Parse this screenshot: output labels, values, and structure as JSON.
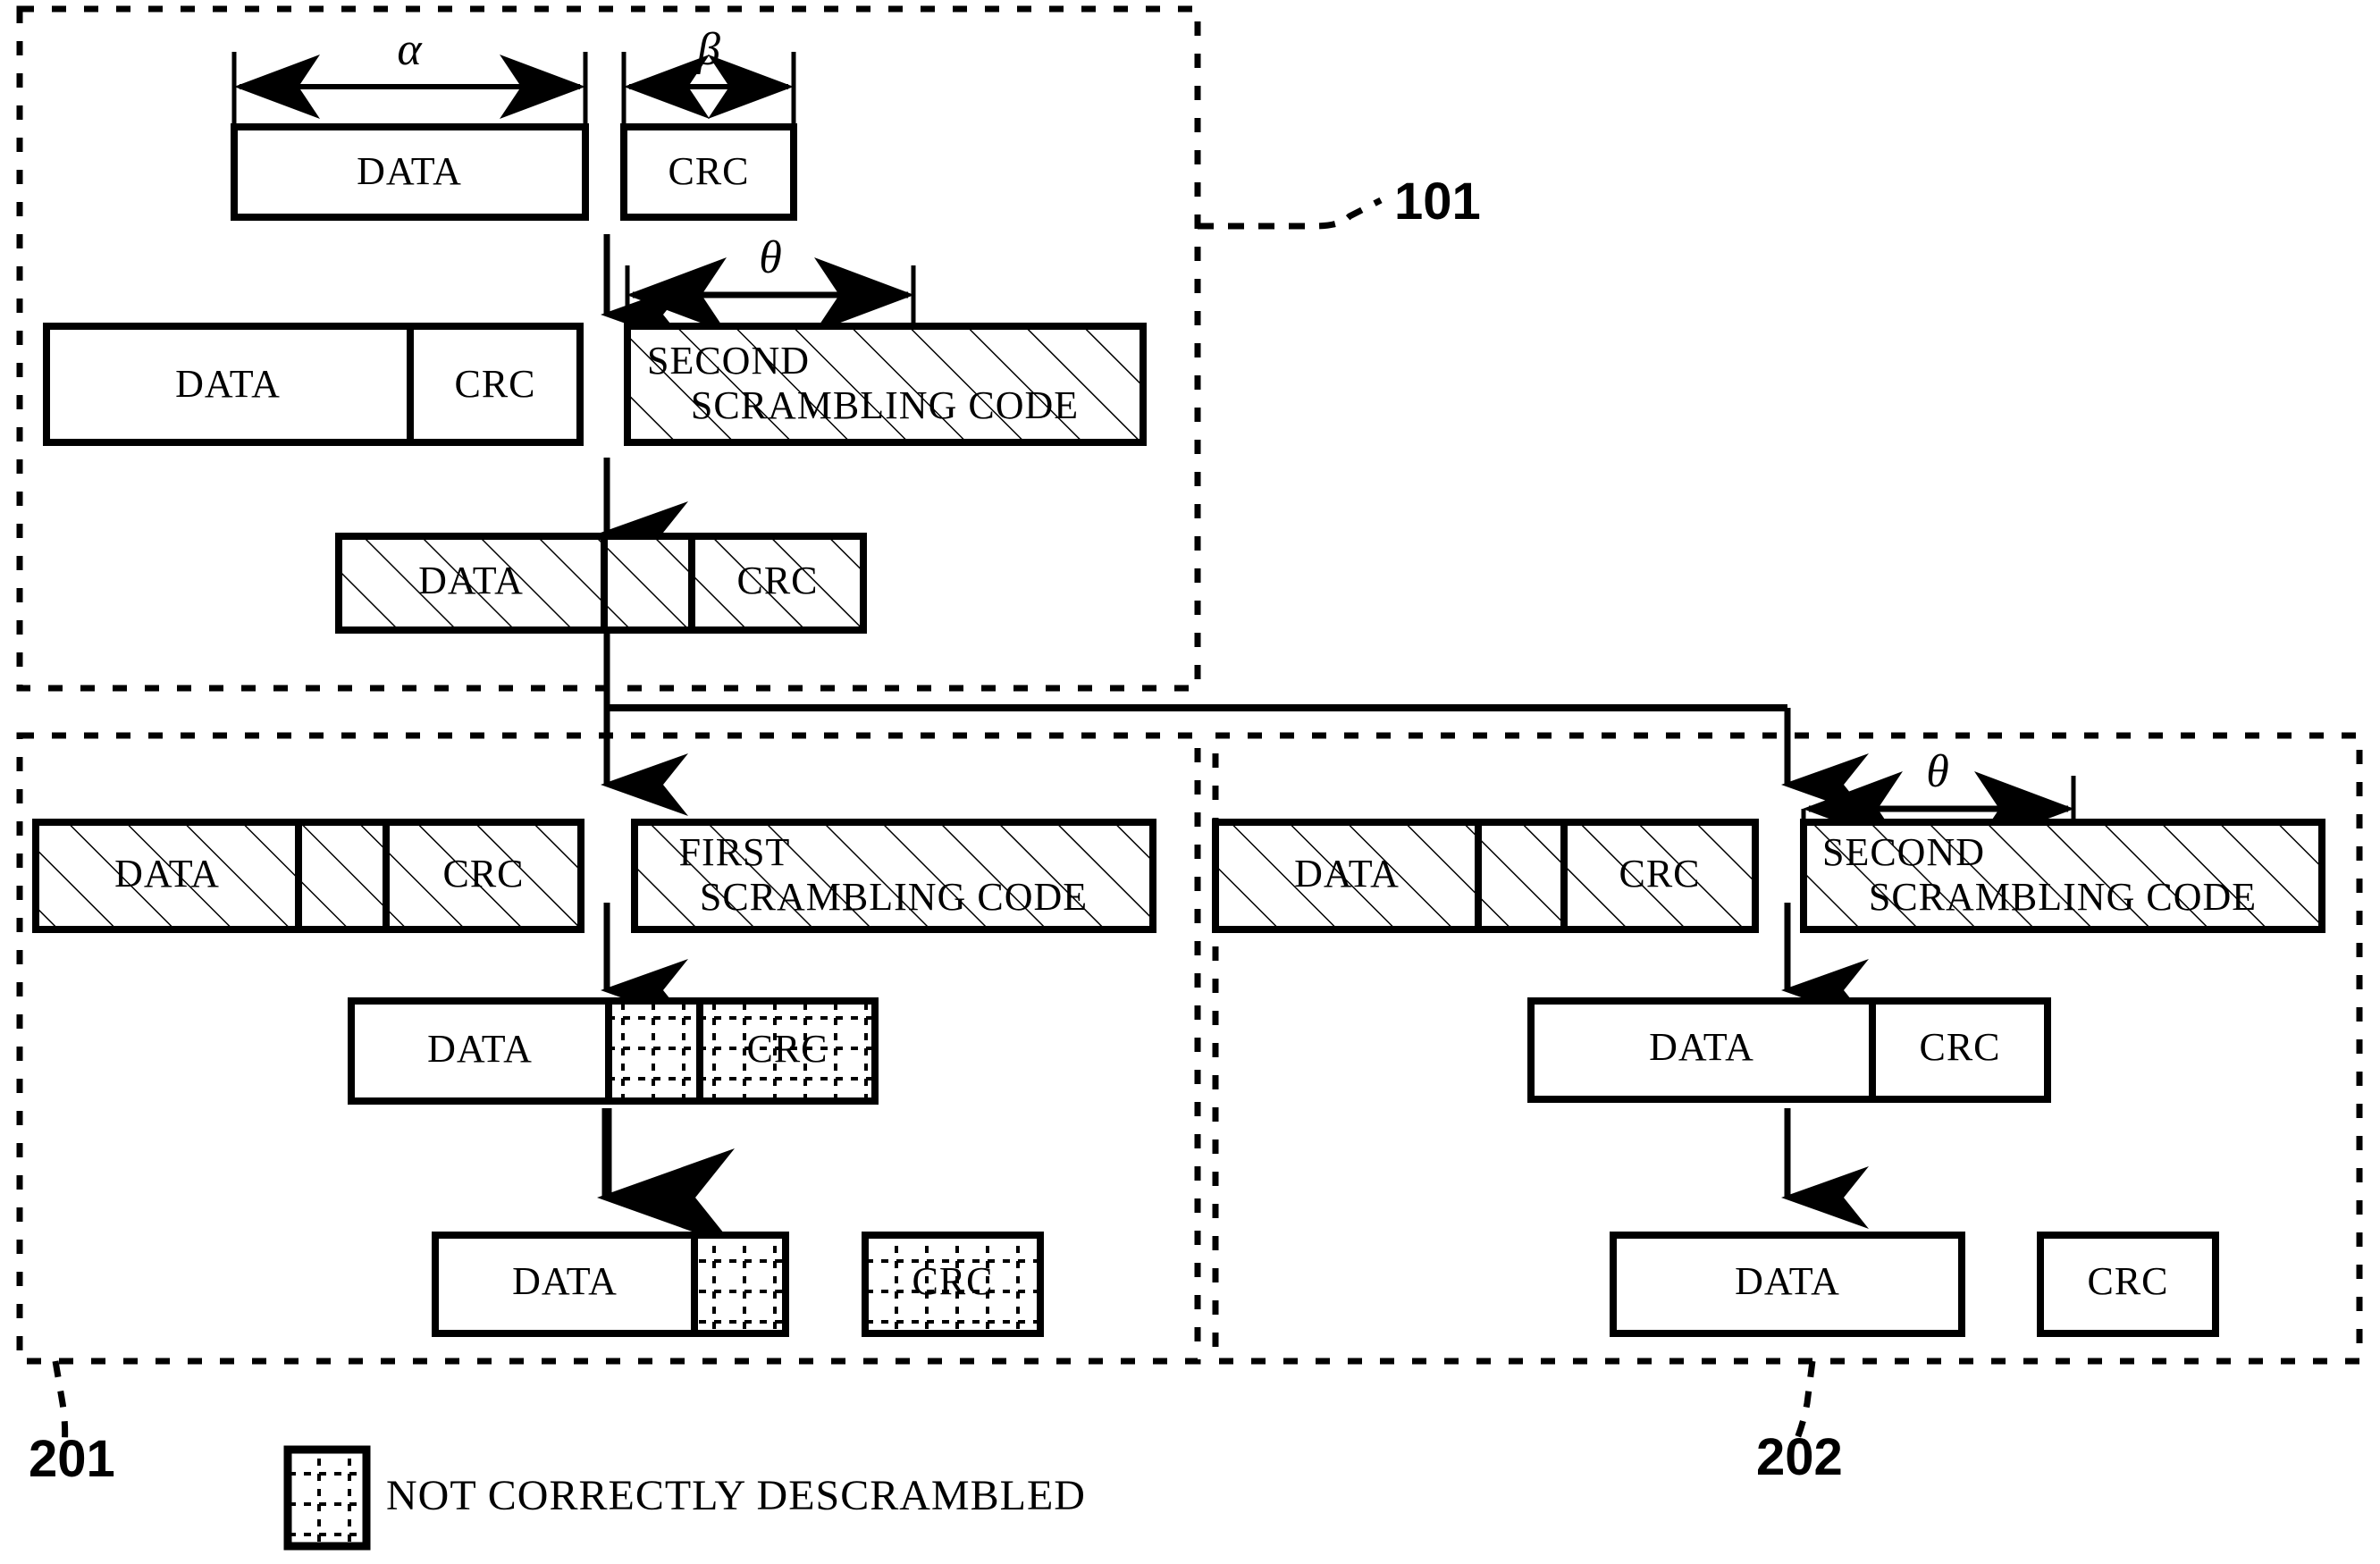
{
  "figure": {
    "type": "patent-block-diagram",
    "panels": [
      {
        "ref": "101",
        "name": "transmitter-panel",
        "rows": [
          {
            "name": "row-original-blocks",
            "blocks": [
              {
                "label": "DATA",
                "fill": "plain",
                "dimension": "α"
              },
              {
                "label": "CRC",
                "fill": "plain",
                "dimension": "β"
              }
            ]
          },
          {
            "name": "row-data-crc-and-code",
            "blocks": [
              {
                "label": "DATA",
                "fill": "plain"
              },
              {
                "label": "CRC",
                "fill": "plain"
              },
              {
                "label": "SECOND SCRAMBLING CODE",
                "fill": "hatched",
                "dimension": "θ"
              }
            ]
          },
          {
            "name": "row-scrambled-output",
            "blocks": [
              {
                "label": "DATA",
                "fill": "hatched"
              },
              {
                "label": "",
                "fill": "hatched"
              },
              {
                "label": "CRC",
                "fill": "hatched"
              }
            ]
          }
        ]
      },
      {
        "ref": "201",
        "name": "receiver-wrong-code-panel",
        "rows": [
          {
            "name": "row-received-and-first-code",
            "blocks": [
              {
                "label": "DATA",
                "fill": "hatched"
              },
              {
                "label": "",
                "fill": "hatched"
              },
              {
                "label": "CRC",
                "fill": "hatched"
              },
              {
                "label": "FIRST SCRAMBLING CODE",
                "fill": "hatched"
              }
            ]
          },
          {
            "name": "row-descrambled-result",
            "blocks": [
              {
                "label": "DATA",
                "fill": "plain"
              },
              {
                "label": "",
                "fill": "dotted"
              },
              {
                "label": "CRC",
                "fill": "dotted"
              }
            ]
          },
          {
            "name": "row-separated-result",
            "blocks": [
              {
                "label": "DATA",
                "fill": "plain"
              },
              {
                "label": "",
                "fill": "dotted"
              },
              {
                "label": "CRC",
                "fill": "dotted"
              }
            ]
          }
        ]
      },
      {
        "ref": "202",
        "name": "receiver-correct-code-panel",
        "rows": [
          {
            "name": "row-received-and-second-code",
            "blocks": [
              {
                "label": "DATA",
                "fill": "hatched"
              },
              {
                "label": "",
                "fill": "hatched"
              },
              {
                "label": "CRC",
                "fill": "hatched"
              },
              {
                "label": "SECOND SCRAMBLING CODE",
                "fill": "hatched",
                "dimension": "θ"
              }
            ]
          },
          {
            "name": "row-descrambled-result",
            "blocks": [
              {
                "label": "DATA",
                "fill": "plain"
              },
              {
                "label": "CRC",
                "fill": "plain"
              }
            ]
          },
          {
            "name": "row-separated-result",
            "blocks": [
              {
                "label": "DATA",
                "fill": "plain"
              },
              {
                "label": "CRC",
                "fill": "plain"
              }
            ]
          }
        ]
      }
    ]
  },
  "labels": {
    "data": "DATA",
    "crc": "CRC",
    "second_scrambling_code_line1": "SECOND",
    "second_scrambling_code_line2": "SCRAMBLING CODE",
    "first_scrambling_code_line1": "FIRST",
    "first_scrambling_code_line2": "SCRAMBLING CODE",
    "alpha": "α",
    "beta": "β",
    "theta": "θ",
    "ref_101": "101",
    "ref_201": "201",
    "ref_202": "202"
  },
  "legend": {
    "swatch_fill": "dotted",
    "text": "NOT CORRECTLY DESCRAMBLED"
  },
  "colors": {
    "stroke": "#000000",
    "background": "#ffffff"
  }
}
